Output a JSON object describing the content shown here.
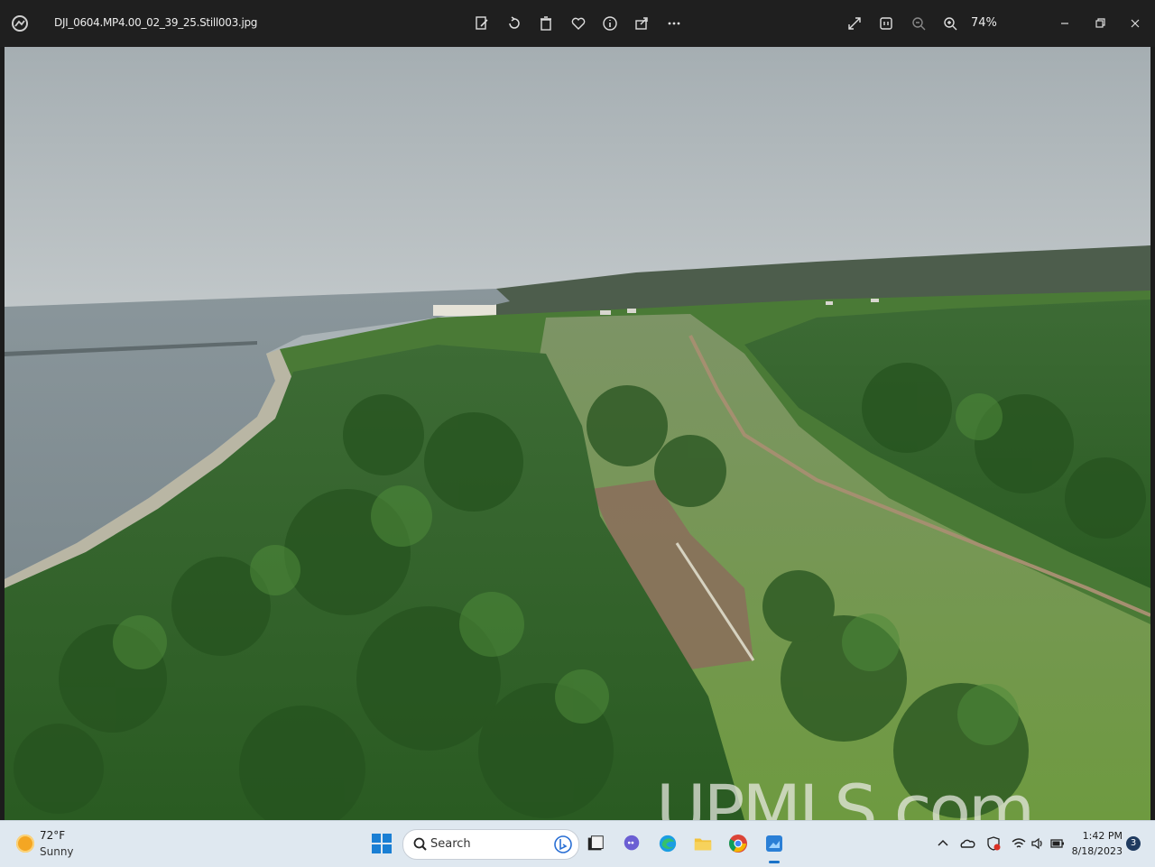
{
  "titlebar": {
    "file_name": "DJI_0604.MP4.00_02_39_25.Still003.jpg",
    "zoom_level": "74%",
    "toolbar_icons": [
      "edit-icon",
      "rotate-icon",
      "delete-icon",
      "favorite-icon",
      "info-icon",
      "share-icon",
      "more-icon"
    ],
    "right_icons": [
      "fullscreen-icon",
      "fit-icon",
      "zoom-out-icon",
      "zoom-in-icon"
    ],
    "window_controls": [
      "minimize-icon",
      "restore-icon",
      "close-icon"
    ]
  },
  "photo": {
    "watermark": "UPMLS.com",
    "sky_color": "#aab3b6",
    "water_color": "#8b979c",
    "forest_color": "#2f6a26",
    "clearing_color": "#7f9b4f"
  },
  "taskbar": {
    "weather": {
      "temp": "72°F",
      "desc": "Sunny"
    },
    "search_placeholder": "Search",
    "apps": [
      "file-explorer-icon",
      "teams-chat-icon",
      "edge-icon",
      "folder-icon",
      "chrome-icon",
      "photos-icon"
    ],
    "tray": [
      "chevron-up-icon",
      "onedrive-icon",
      "antivirus-icon",
      "wifi-icon",
      "volume-icon",
      "battery-icon"
    ],
    "clock": {
      "time": "1:42 PM",
      "date": "8/18/2023"
    },
    "notifications": "3"
  }
}
